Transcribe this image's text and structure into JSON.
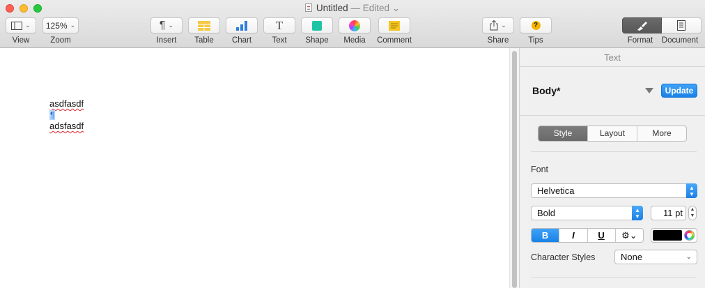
{
  "window": {
    "title": "Untitled",
    "status": "— Edited",
    "title_chevron": "⌄"
  },
  "toolbar": {
    "view_label": "View",
    "zoom_value": "125%",
    "zoom_label": "Zoom",
    "insert_label": "Insert",
    "table_label": "Table",
    "chart_label": "Chart",
    "text_label": "Text",
    "text_glyph": "T",
    "shape_label": "Shape",
    "media_label": "Media",
    "comment_label": "Comment",
    "share_label": "Share",
    "tips_label": "Tips",
    "tips_glyph": "?",
    "format_label": "Format",
    "document_label": "Document",
    "pilcrow_glyph": "¶",
    "chevron": "⌄"
  },
  "document": {
    "lines": [
      "asdfasdf",
      "¶",
      "adsfasdf"
    ]
  },
  "inspector": {
    "header": "Text",
    "paragraph_style": "Body*",
    "update_label": "Update",
    "tabs": [
      "Style",
      "Layout",
      "More"
    ],
    "active_tab": "Style",
    "font_label": "Font",
    "font_family": "Helvetica",
    "font_typeface": "Bold",
    "font_size": "11 pt",
    "bold_glyph": "B",
    "italic_glyph": "I",
    "underline_glyph": "U",
    "gear_glyph": "⚙︎⌄",
    "text_color": "#000000",
    "char_styles_label": "Character Styles",
    "char_styles_value": "None"
  },
  "colors": {
    "accent": "#1a82e8",
    "close": "#fe5f57",
    "minimize": "#febc2e",
    "maximize": "#28c840",
    "table_icon": "#f6c945",
    "chart_icon": "#2e7fdc",
    "shape_icon": "#1fc4a4",
    "comment_icon": "#f5c524"
  }
}
